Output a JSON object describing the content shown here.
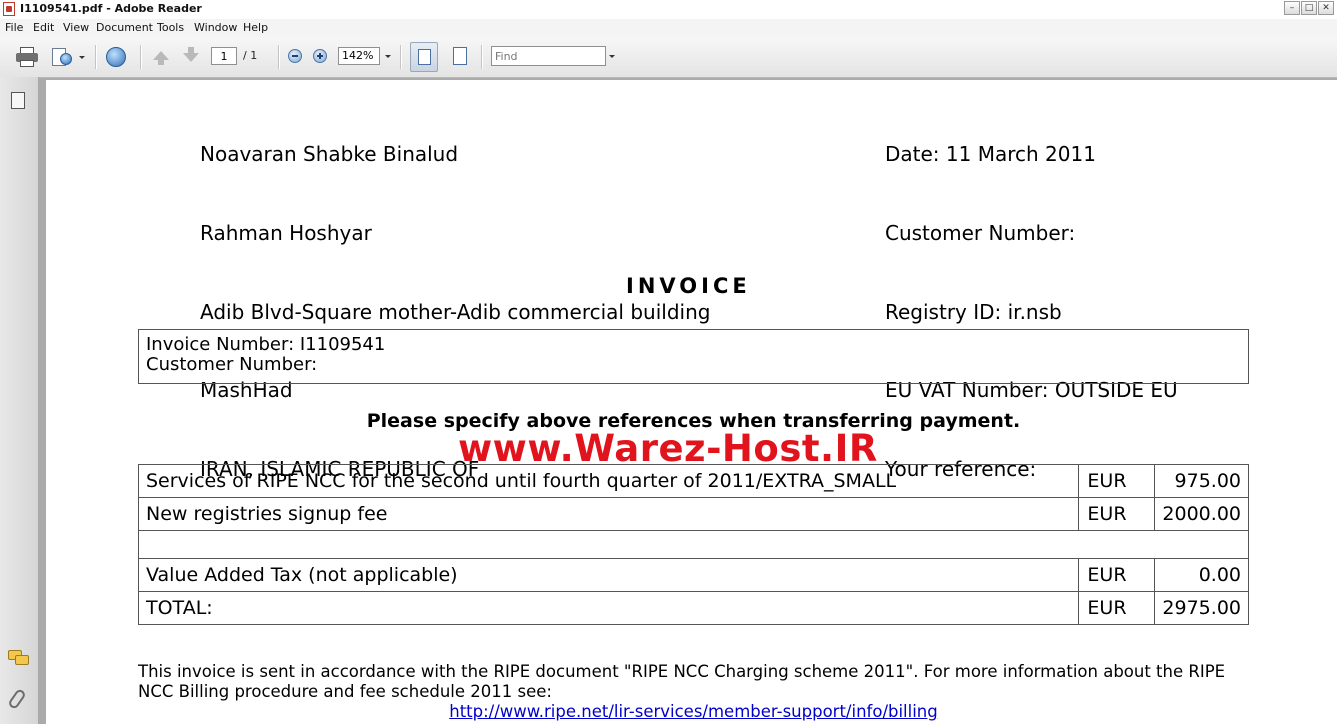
{
  "window": {
    "title": "I1109541.pdf - Adobe Reader"
  },
  "menu": [
    "File",
    "Edit",
    "View",
    "Document",
    "Tools",
    "Window",
    "Help"
  ],
  "toolbar": {
    "page_current": "1",
    "page_total": "/ 1",
    "zoom": "142%",
    "find_placeholder": "Find"
  },
  "document": {
    "recipient": [
      "Noavaran Shabke Binalud",
      "Rahman Hoshyar",
      "Adib Blvd-Square mother-Adib commercial building",
      "MashHad",
      "IRAN, ISLAMIC REPUBLIC OF"
    ],
    "meta": [
      "Date: 11 March 2011",
      "Customer Number:",
      "Registry ID: ir.nsb",
      "EU VAT Number: OUTSIDE EU",
      "Your reference:"
    ],
    "title": "INVOICE",
    "invoice_number": "Invoice Number: I1109541",
    "customer_number": "Customer Number:",
    "notice": "Please specify above references when transferring payment.",
    "watermark": "www.Warez-Host.IR",
    "items": [
      {
        "description": "Services of RIPE NCC for the second until fourth quarter of 2011/EXTRA_SMALL",
        "currency": "EUR",
        "amount": "975.00"
      },
      {
        "description": "New registries signup fee",
        "currency": "EUR",
        "amount": "2000.00"
      },
      {
        "description": "",
        "currency": "",
        "amount": ""
      },
      {
        "description": "Value Added Tax (not applicable)",
        "currency": "EUR",
        "amount": "0.00"
      },
      {
        "description": "TOTAL:",
        "currency": "EUR",
        "amount": "2975.00"
      }
    ],
    "footer_text": "This invoice is sent in accordance with the RIPE document \"RIPE NCC Charging scheme 2011\". For more information about the RIPE NCC Billing procedure and fee schedule 2011 see:",
    "footer_link": "http://www.ripe.net/lir-services/member-support/info/billing"
  }
}
